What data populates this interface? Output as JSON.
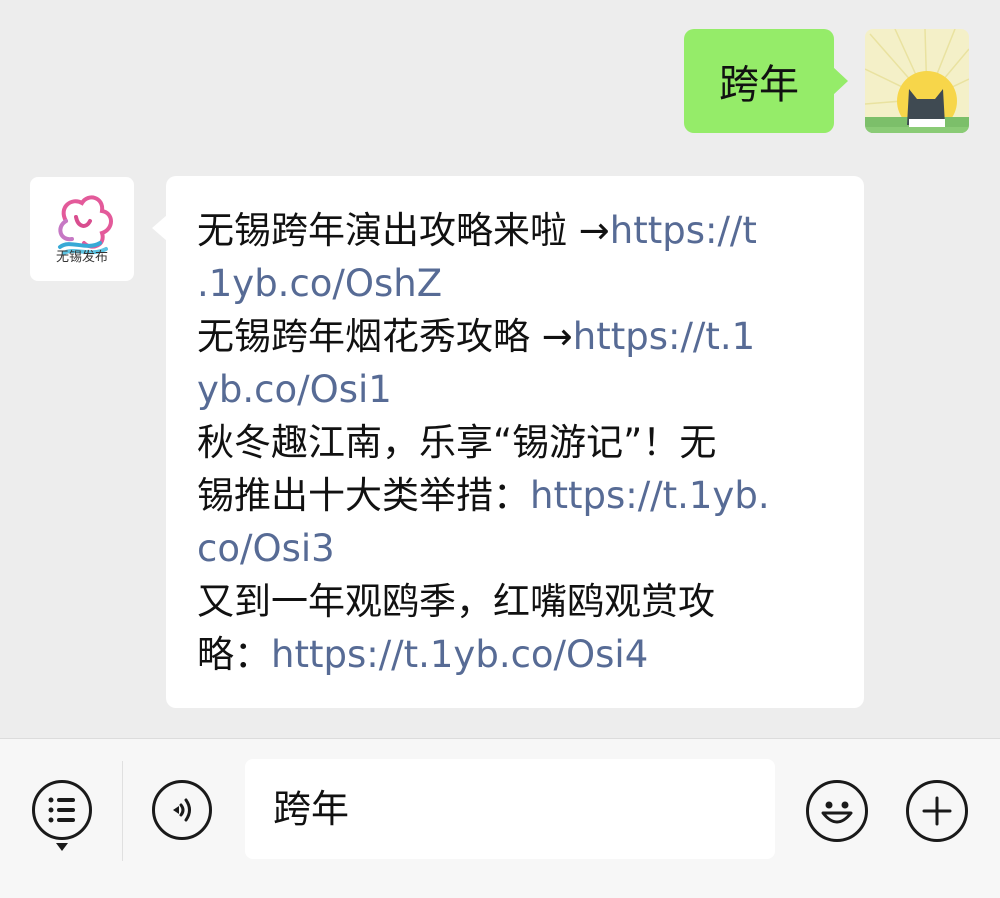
{
  "outgoing": {
    "text": "跨年"
  },
  "incoming": {
    "sender_name": "无锡发布",
    "lines": [
      {
        "text": "无锡跨年演出攻略来啦 →",
        "link": "https://t"
      },
      {
        "text": "",
        "link": ".1yb.co/OshZ"
      },
      {
        "text": "无锡跨年烟花秀攻略 →",
        "link": "https://t.1"
      },
      {
        "text": "",
        "link": "yb.co/Osi1"
      },
      {
        "text": "秋冬趣江南，乐享“锡游记”！无",
        "link": ""
      },
      {
        "text": "锡推出十大类举措：",
        "link": "https://t.1yb."
      },
      {
        "text": "",
        "link": "co/Osi3"
      },
      {
        "text": "又到一年观鸥季，红嘴鸥观赏攻",
        "link": ""
      },
      {
        "text": "略：",
        "link": "https://t.1yb.co/Osi4"
      }
    ]
  },
  "input_bar": {
    "value": "跨年",
    "icons": [
      "menu-list-icon",
      "voice-icon",
      "emoji-icon",
      "plus-icon"
    ]
  },
  "colors": {
    "background": "#ededed",
    "outgoing_bubble": "#95ec69",
    "incoming_bubble": "#ffffff",
    "link": "#576b95"
  }
}
